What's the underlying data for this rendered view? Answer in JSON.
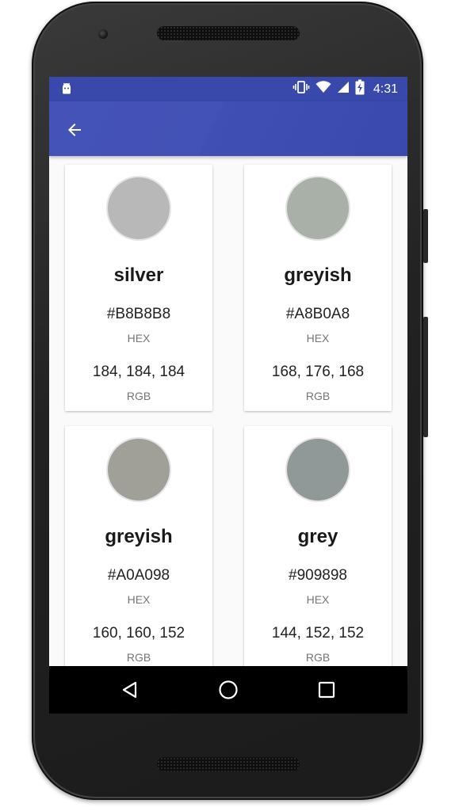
{
  "status_bar": {
    "time": "4:31",
    "notification_icon": "android-icon",
    "icons": [
      "vibrate-icon",
      "wifi-icon",
      "signal-icon",
      "battery-charging-icon"
    ]
  },
  "app_bar": {
    "back_icon": "arrow-back-icon",
    "color": "#3f51b5"
  },
  "colors": [
    {
      "name": "silver",
      "hex": "#B8B8B8",
      "hex_label": "HEX",
      "rgb": "184, 184, 184",
      "rgb_label": "RGB"
    },
    {
      "name": "greyish",
      "hex": "#A8B0A8",
      "hex_label": "HEX",
      "rgb": "168, 176, 168",
      "rgb_label": "RGB"
    },
    {
      "name": "greyish",
      "hex": "#A0A098",
      "hex_label": "HEX",
      "rgb": "160, 160, 152",
      "rgb_label": "RGB"
    },
    {
      "name": "grey",
      "hex": "#909898",
      "hex_label": "HEX",
      "rgb": "144, 152, 152",
      "rgb_label": "RGB"
    }
  ],
  "nav_bar": {
    "icons": [
      "back-triangle-icon",
      "home-circle-icon",
      "recents-square-icon"
    ]
  }
}
